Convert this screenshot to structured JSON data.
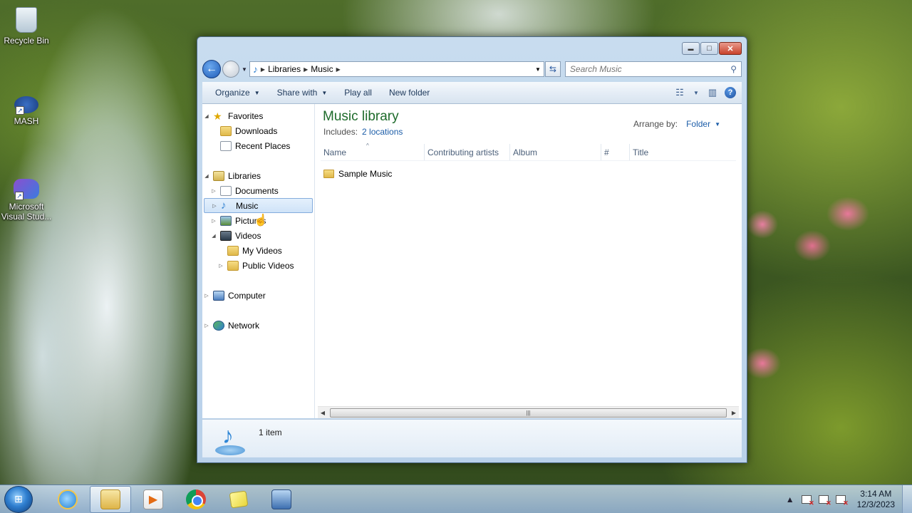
{
  "desktop": {
    "icons": [
      {
        "label": "Recycle Bin",
        "icon": "recycle-bin-icon"
      },
      {
        "label": "MASH",
        "icon": "mash-app-icon"
      },
      {
        "label": "Microsoft Visual Stud...",
        "icon": "visual-studio-icon"
      }
    ]
  },
  "window": {
    "caption_buttons": {
      "minimize": "▬",
      "maximize": "□",
      "close": "✕"
    },
    "address": {
      "crumbs": [
        "Libraries",
        "Music"
      ]
    },
    "search": {
      "placeholder": "Search Music"
    },
    "toolbar": {
      "organize": "Organize",
      "share_with": "Share with",
      "play_all": "Play all",
      "new_folder": "New folder"
    },
    "nav": {
      "favorites": "Favorites",
      "downloads": "Downloads",
      "recent_places": "Recent Places",
      "libraries": "Libraries",
      "documents": "Documents",
      "music": "Music",
      "pictures": "Pictures",
      "videos": "Videos",
      "my_videos": "My Videos",
      "public_videos": "Public Videos",
      "computer": "Computer",
      "network": "Network"
    },
    "library": {
      "title": "Music library",
      "includes_label": "Includes:",
      "locations_link": "2 locations",
      "arrange_by_label": "Arrange by:",
      "arrange_by_value": "Folder"
    },
    "columns": [
      "Name",
      "Contributing artists",
      "Album",
      "#",
      "Title"
    ],
    "items": [
      {
        "name": "Sample Music",
        "type": "folder"
      }
    ],
    "details": {
      "count": "1 item"
    }
  },
  "taskbar": {
    "apps": [
      {
        "name": "internet-explorer",
        "active": false
      },
      {
        "name": "windows-explorer",
        "active": true
      },
      {
        "name": "windows-media-player",
        "active": false
      },
      {
        "name": "google-chrome",
        "active": false
      },
      {
        "name": "sticky-notes",
        "active": false
      },
      {
        "name": "network-app",
        "active": false
      }
    ],
    "clock": {
      "time": "3:14 AM",
      "date": "12/3/2023"
    }
  }
}
